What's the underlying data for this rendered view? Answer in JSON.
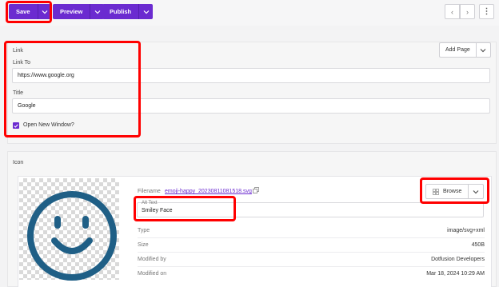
{
  "toolbar": {
    "save_label": "Save",
    "preview_label": "Preview",
    "publish_label": "Publish",
    "prev_glyph": "‹",
    "next_glyph": "›",
    "more_glyph": "⋮",
    "caret_glyph": "⌄"
  },
  "link": {
    "section_title": "Link",
    "link_to_label": "Link To",
    "link_to_value": "https://www.google.org",
    "title_label": "Title",
    "title_value": "Google",
    "open_new_window_label": "Open New Window?",
    "open_new_window_checked": true,
    "add_page_label": "Add Page"
  },
  "icon": {
    "section_title": "Icon",
    "filename_label": "Filename",
    "filename_value": "emoji-happy_20230811081518.svg",
    "alt_text_label": "Alt Text",
    "alt_text_value": "Smiley Face",
    "browse_label": "Browse",
    "type_label": "Type",
    "type_value": "image/svg+xml",
    "size_label": "Size",
    "size_value": "450B",
    "modified_by_label": "Modified by",
    "modified_by_value": "Dotfusion Developers",
    "modified_on_label": "Modified on",
    "modified_on_value": "Mar 18, 2024 10:29 AM"
  },
  "colors": {
    "accent": "#6b2bd0",
    "annotation": "#ff0000",
    "smiley": "#1f5f86"
  }
}
